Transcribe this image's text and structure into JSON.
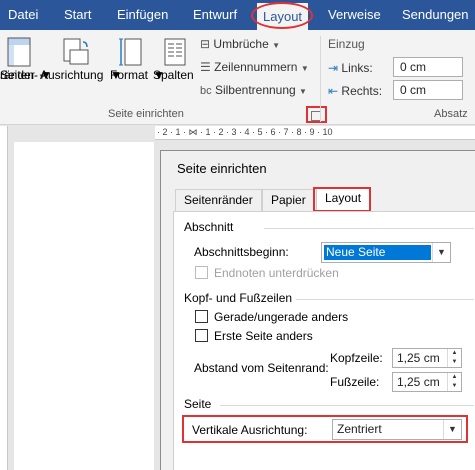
{
  "ribbon_tabs": [
    "Datei",
    "Start",
    "Einfügen",
    "Entwurf",
    "Layout",
    "Verweise",
    "Sendungen"
  ],
  "active_tab": "Layout",
  "ribbon": {
    "margins_label_line1": "Seiten-",
    "margins_label_line2": "ränder",
    "orientation_label": "Ausrichtung",
    "size_label": "Format",
    "columns_label": "Spalten",
    "breaks_label": "Umbrüche",
    "line_numbers_label": "Zeilennummern",
    "hyphenation_label": "Silbentrennung",
    "page_setup_group": "Seite einrichten",
    "indent_header": "Einzug",
    "indent_left_label": "Links:",
    "indent_left_value": "0 cm",
    "indent_right_label": "Rechts:",
    "indent_right_value": "0 cm",
    "paragraph_group": "Absatz"
  },
  "ruler_text": "· 2 · 1 · ⋈ · 1 · 2 · 3 · 4 · 5 · 6 · 7 · 8 · 9 · 10",
  "dialog": {
    "title": "Seite einrichten",
    "tabs": [
      "Seitenränder",
      "Papier",
      "Layout"
    ],
    "active_tab": "Layout",
    "section_header": "Abschnitt",
    "section_start_label": "Abschnittsbeginn:",
    "section_start_value": "Neue Seite",
    "suppress_endnotes_label": "Endnoten unterdrücken",
    "header_footer_header": "Kopf- und Fußzeilen",
    "odd_even_label": "Gerade/ungerade anders",
    "first_page_label": "Erste Seite anders",
    "from_edge_label": "Abstand vom Seitenrand:",
    "header_label": "Kopfzeile:",
    "header_value": "1,25 cm",
    "footer_label": "Fußzeile:",
    "footer_value": "1,25 cm",
    "page_header": "Seite",
    "vertical_alignment_label": "Vertikale Ausrichtung:",
    "vertical_alignment_value": "Zentriert"
  },
  "colors": {
    "ribbon_blue": "#2b579a",
    "highlight_red": "#e03232",
    "selection_blue": "#0078d7"
  }
}
